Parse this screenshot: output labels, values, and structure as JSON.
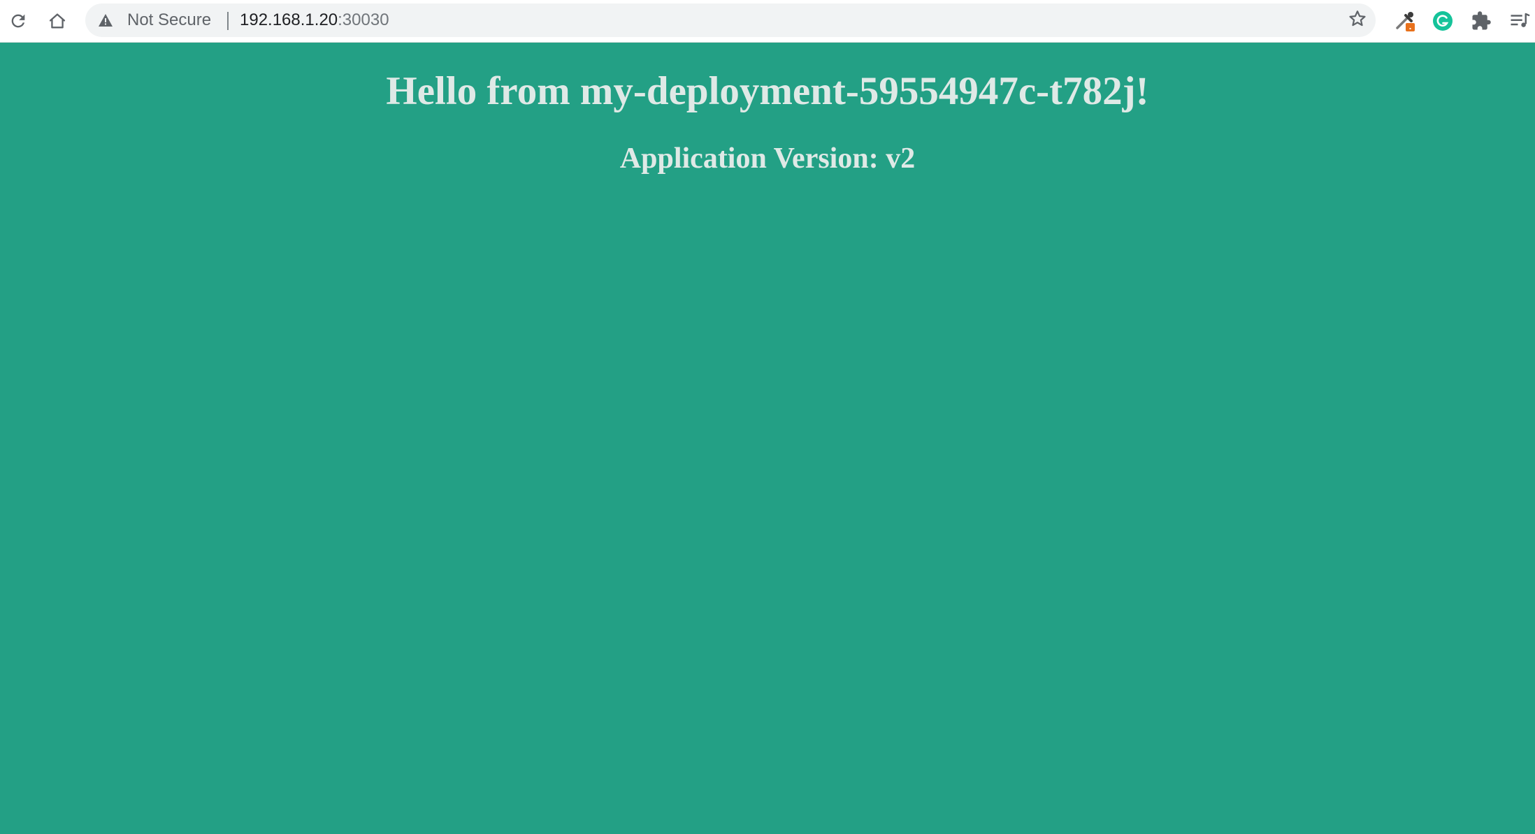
{
  "browser": {
    "address_bar": {
      "security_label": "Not Secure",
      "url_host": "192.168.1.20",
      "url_port": ":30030"
    },
    "icons": {
      "reload": "reload-icon",
      "home": "home-icon",
      "warning": "warning-icon",
      "bookmark": "star-icon",
      "extension_eyedropper": "eyedropper-extension-icon",
      "extension_grammarly": "grammarly-extension-icon",
      "extensions_menu": "puzzle-icon",
      "media_control": "media-playlist-icon"
    },
    "colors": {
      "grammarly": "#15c39a",
      "extension_badge": "#e8711c"
    }
  },
  "page": {
    "background": "#23a085",
    "heading": "Hello from my-deployment-59554947c-t782j!",
    "version_line": "Application Version: v2"
  }
}
